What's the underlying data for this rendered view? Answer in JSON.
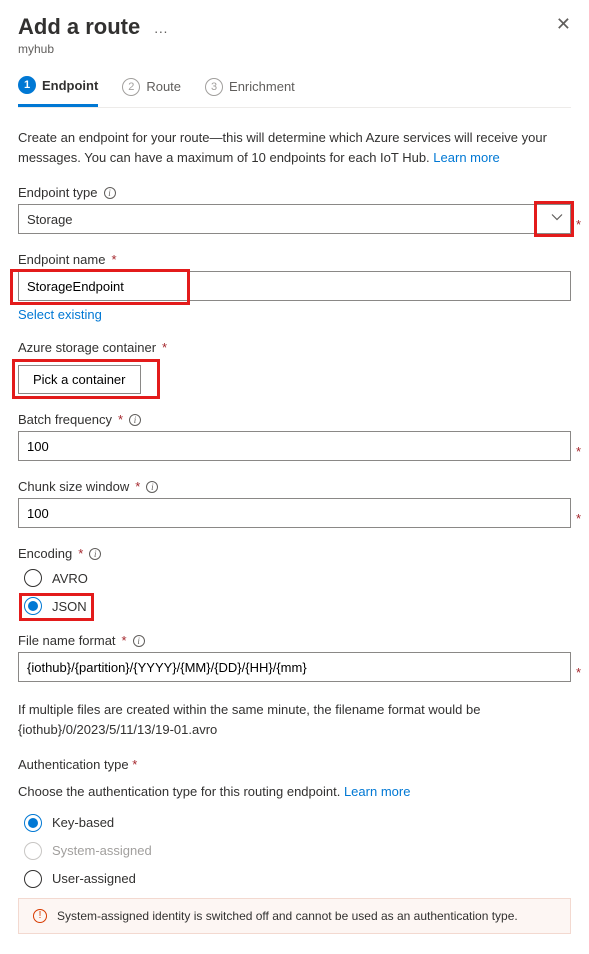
{
  "header": {
    "title": "Add a route",
    "subtitle": "myhub"
  },
  "stepper": {
    "steps": [
      {
        "num": "1",
        "label": "Endpoint"
      },
      {
        "num": "2",
        "label": "Route"
      },
      {
        "num": "3",
        "label": "Enrichment"
      }
    ]
  },
  "intro": {
    "text": "Create an endpoint for your route—this will determine which Azure services will receive your messages. You can have a maximum of 10 endpoints for each IoT Hub. ",
    "link": "Learn more"
  },
  "endpoint_type": {
    "label": "Endpoint type",
    "value": "Storage"
  },
  "endpoint_name": {
    "label": "Endpoint name",
    "value": "StorageEndpoint",
    "select_existing": "Select existing"
  },
  "storage_container": {
    "label": "Azure storage container",
    "button": "Pick a container"
  },
  "batch_frequency": {
    "label": "Batch frequency",
    "value": "100"
  },
  "chunk_size": {
    "label": "Chunk size window",
    "value": "100"
  },
  "encoding": {
    "label": "Encoding",
    "options": {
      "avro": "AVRO",
      "json": "JSON"
    }
  },
  "file_format": {
    "label": "File name format",
    "value": "{iothub}/{partition}/{YYYY}/{MM}/{DD}/{HH}/{mm}",
    "helper": "If multiple files are created within the same minute, the filename format would be {iothub}/0/2023/5/11/13/19-01.avro"
  },
  "auth_type": {
    "label": "Authentication type",
    "description": "Choose the authentication type for this routing endpoint. ",
    "link": "Learn more",
    "options": {
      "key": "Key-based",
      "system": "System-assigned",
      "user": "User-assigned"
    }
  },
  "warning": {
    "text": "System-assigned identity is switched off and cannot be used as an authentication type."
  }
}
